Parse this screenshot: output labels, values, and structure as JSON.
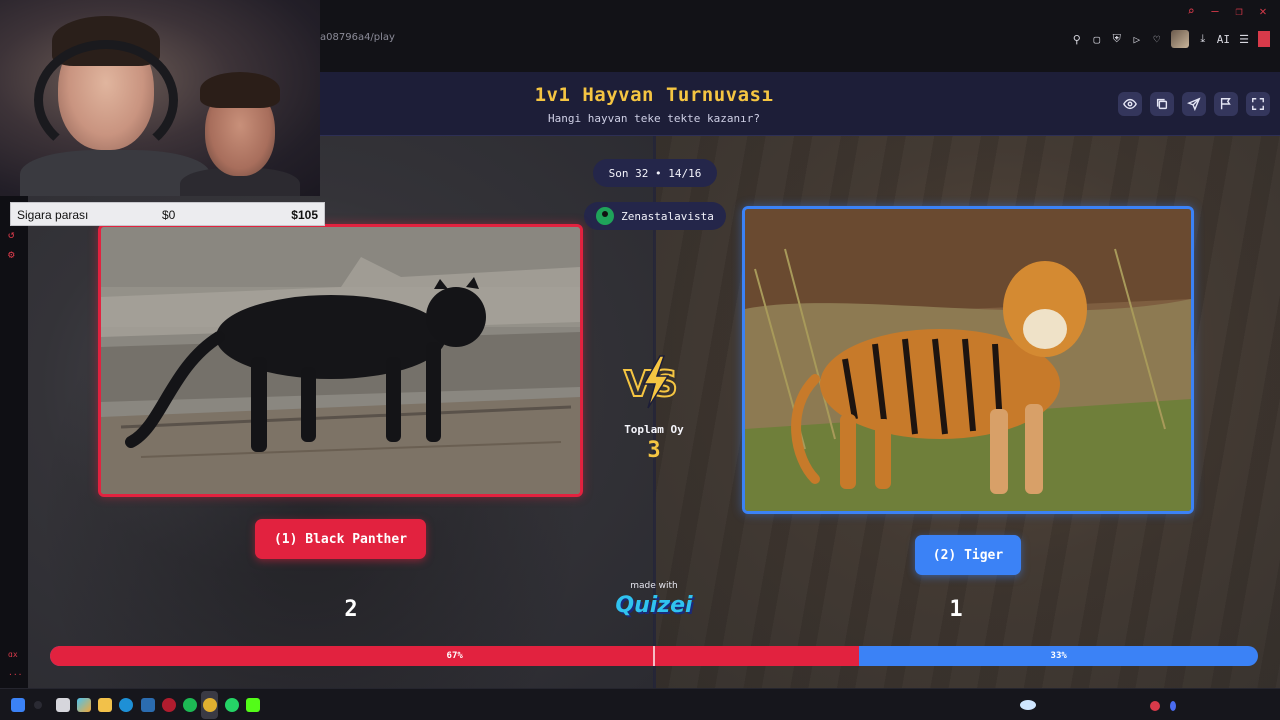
{
  "browser": {
    "url_fragment": "a08796a4/play",
    "toolbar_ai_label": "AI"
  },
  "webcam_overlay": {
    "label": "Sigara parası",
    "min_value": "$0",
    "max_value": "$105"
  },
  "app": {
    "title": "1v1 Hayvan Turnuvası",
    "subtitle": "Hangi hayvan teke tekte kazanır?",
    "header_actions": [
      "eye-icon",
      "copy-icon",
      "send-icon",
      "flag-icon",
      "fullscreen-icon"
    ],
    "round": "Son 32 • 14/16",
    "user": "Zenastalavista",
    "vs_label": "VS",
    "total_votes_label": "Toplam Oy",
    "total_votes_value": "3",
    "made_with": "made with",
    "brand": "Quizei"
  },
  "contestants": {
    "left": {
      "label": "(1) Black Panther",
      "votes": "2",
      "percent": "67%",
      "percent_value": 67,
      "color": "#e2223f"
    },
    "right": {
      "label": "(2) Tiger",
      "votes": "1",
      "percent": "33%",
      "percent_value": 33,
      "color": "#3b82f6"
    }
  },
  "colors": {
    "accent": "#f5c542",
    "header_bg": "#1d1e38",
    "pill_bg": "#24264a"
  }
}
